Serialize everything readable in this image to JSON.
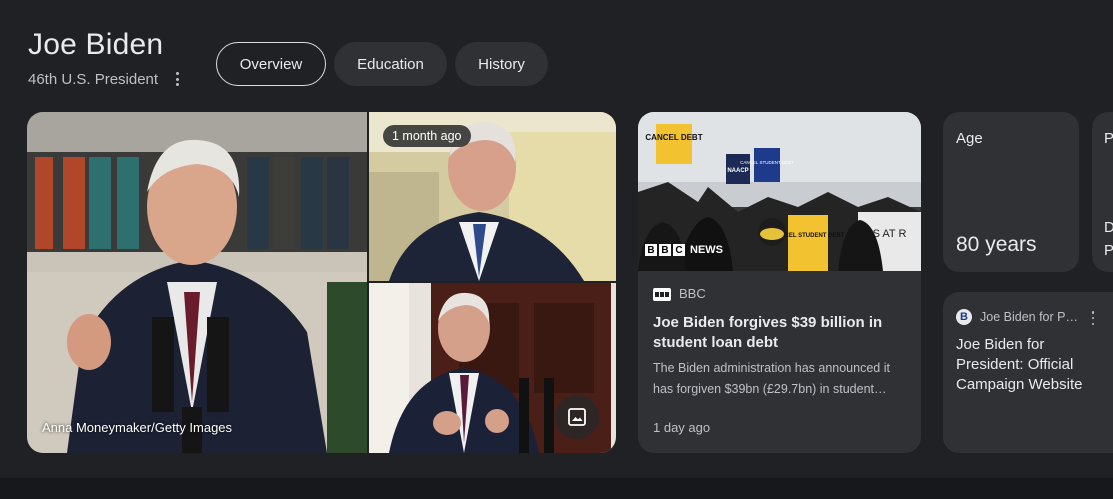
{
  "header": {
    "title": "Joe Biden",
    "subtitle": "46th U.S. President"
  },
  "tabs": [
    {
      "label": "Overview",
      "active": true
    },
    {
      "label": "Education",
      "active": false
    },
    {
      "label": "History",
      "active": false
    }
  ],
  "images": {
    "main_caption": "Anna Moneymaker/Getty Images",
    "top_right_badge": "1 month ago",
    "gallery_icon": "image-gallery-icon"
  },
  "news": {
    "image_brand": "BBC NEWS",
    "image_brand_letters": [
      "B",
      "B",
      "C"
    ],
    "image_brand_word": "NEWS",
    "source": "BBC",
    "title": "Joe Biden forgives $39 billion in student loan debt",
    "snippet": "The Biden administration has announced it has forgiven $39bn (£29.7bn) in student…",
    "time": "1 day ago",
    "signs": [
      "CANCEL DEBT",
      "NAACP",
      "CANCEL STUDENT DEBT",
      "IS AT R",
      "CANCEL STUDENT DEBT"
    ]
  },
  "facts": {
    "age_label": "Age",
    "age_value": "80 years",
    "next_label_initial": "P",
    "next_line_1_initial": "D",
    "next_line_2_initial": "P"
  },
  "website": {
    "favicon": "B",
    "source": "Joe Biden for P…",
    "title": "Joe Biden for President: Official Campaign Website"
  },
  "colors": {
    "background": "#202124",
    "card": "#303134",
    "text_primary": "#e8eaed",
    "text_secondary": "#bdc1c6"
  }
}
